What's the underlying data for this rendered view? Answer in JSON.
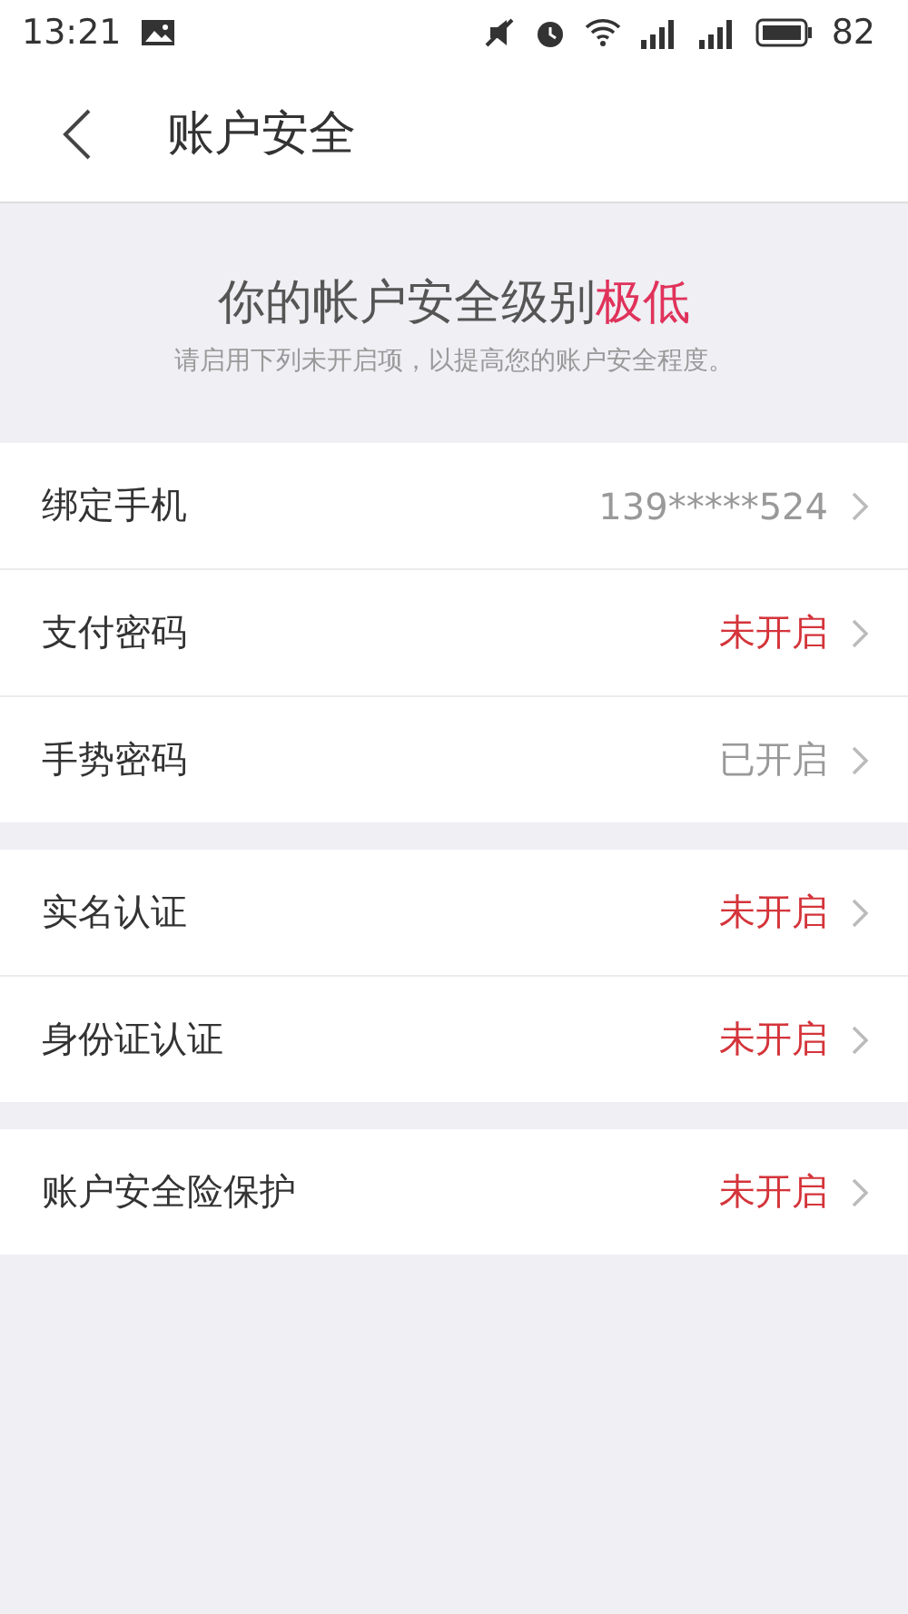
{
  "status_bar": {
    "time": "13:21",
    "battery": "82"
  },
  "header": {
    "title": "账户安全"
  },
  "banner": {
    "title": "你的帐户安全级别",
    "level": "极低",
    "hint": "请启用下列未开启项，以提高您的账户安全程度。"
  },
  "groups": [
    {
      "items": [
        {
          "label": "绑定手机",
          "value": "139*****524",
          "kind": "value"
        },
        {
          "label": "支付密码",
          "value": "未开启",
          "kind": "status",
          "enabled": false
        },
        {
          "label": "手势密码",
          "value": "已开启",
          "kind": "status",
          "enabled": true
        }
      ]
    },
    {
      "items": [
        {
          "label": "实名认证",
          "value": "未开启",
          "kind": "status",
          "enabled": false
        },
        {
          "label": "身份证认证",
          "value": "未开启",
          "kind": "status",
          "enabled": false
        }
      ]
    },
    {
      "items": [
        {
          "label": "账户安全险保护",
          "value": "未开启",
          "kind": "status",
          "enabled": false
        }
      ]
    }
  ]
}
